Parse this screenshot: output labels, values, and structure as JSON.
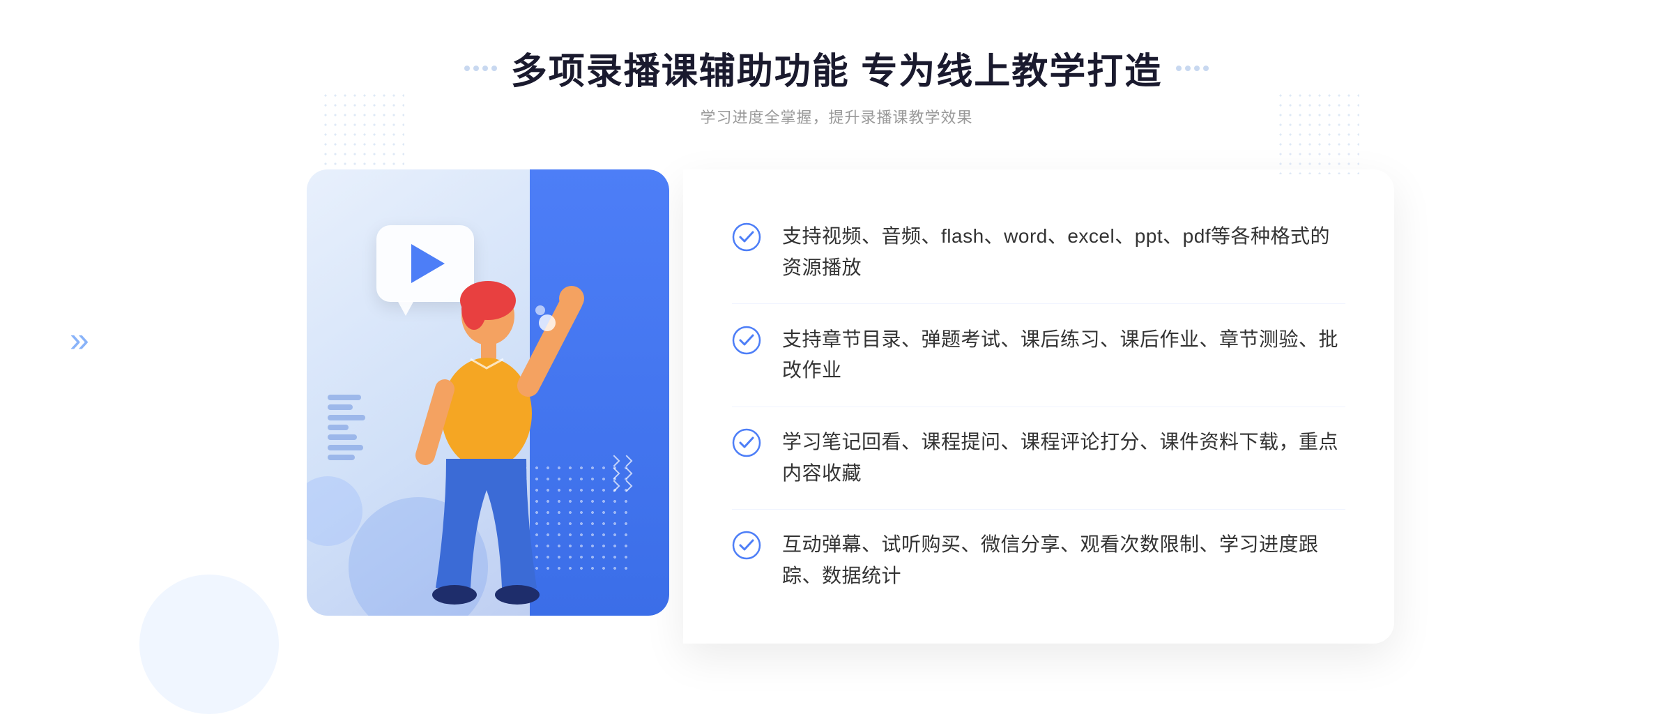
{
  "header": {
    "main_title": "多项录播课辅助功能 专为线上教学打造",
    "sub_title": "学习进度全掌握，提升录播课教学效果"
  },
  "features": [
    {
      "id": "feature-1",
      "text": "支持视频、音频、flash、word、excel、ppt、pdf等各种格式的资源播放"
    },
    {
      "id": "feature-2",
      "text": "支持章节目录、弹题考试、课后练习、课后作业、章节测验、批改作业"
    },
    {
      "id": "feature-3",
      "text": "学习笔记回看、课程提问、课程评论打分、课件资料下载，重点内容收藏"
    },
    {
      "id": "feature-4",
      "text": "互动弹幕、试听购买、微信分享、观看次数限制、学习进度跟踪、数据统计"
    }
  ],
  "colors": {
    "accent_blue": "#4d7ef7",
    "title_color": "#1a1a2e",
    "text_color": "#333333",
    "sub_text_color": "#999999",
    "check_color": "#4d7ef7",
    "bg_light": "#eef3fd"
  },
  "icons": {
    "check_circle": "check-circle-icon",
    "play": "play-icon",
    "chevron_left": "chevron-left-icon"
  }
}
